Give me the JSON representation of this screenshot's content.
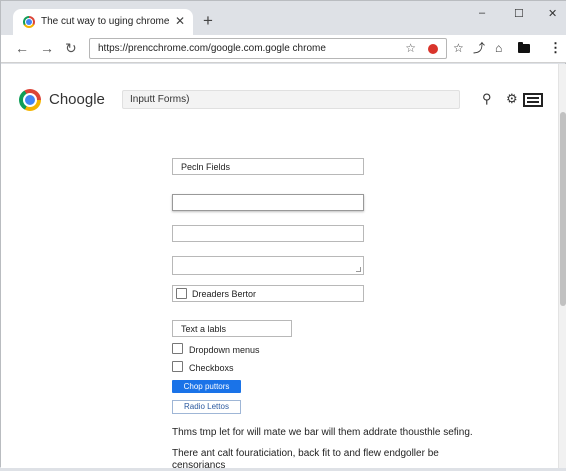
{
  "tab": {
    "title": "The cut way to uging chrome",
    "close": "✕",
    "new_tab": "+"
  },
  "window_controls": {
    "minimize": "–",
    "maximize": "☐",
    "close": "✕"
  },
  "toolbar": {
    "back": "←",
    "forward": "→",
    "reload": "↻",
    "url": "https://prencchrome.com/google.com.gogle chrome",
    "bookmark_star": "☆",
    "extension_badge": "●",
    "star2": "☆",
    "share": "⤴",
    "home": "⌂",
    "menu": "⋮"
  },
  "page": {
    "brand": "Choogle",
    "search_value": "Inputt Forms)",
    "key_icon": "⚲",
    "settings_icon": "⚙"
  },
  "form": {
    "field1": "Pecln Fields",
    "checkbox_field_label": "Dreaders Bertor",
    "text_labels": "Text a labls",
    "dropdown_menus": "Dropdown menus",
    "checkboxes": "Checkboxs",
    "chop_button": "Chop puttors",
    "radio_button": "Radio Lettos"
  },
  "content": {
    "paragraph1": "Thms tmp let for will mate we bar will them addrate thousthle sefing.",
    "paragraph2_line1": "There ant calt fouraticiation, back fit to and flew endgoller be",
    "paragraph2_line2": "censoriancs"
  }
}
